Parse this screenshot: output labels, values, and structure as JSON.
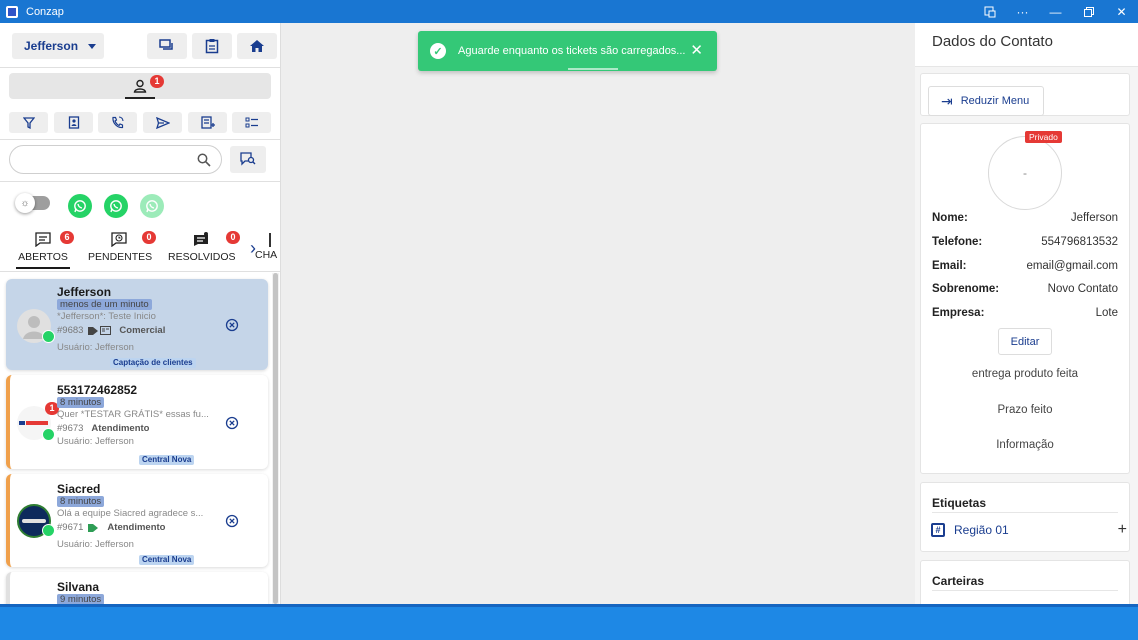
{
  "window": {
    "title": "Conzap"
  },
  "header": {
    "user_name": "Jefferson"
  },
  "person_tab": {
    "badge": "1"
  },
  "search": {
    "placeholder": ""
  },
  "tabs": [
    {
      "label": "ABERTOS",
      "badge": "6"
    },
    {
      "label": "PENDENTES",
      "badge": "0"
    },
    {
      "label": "RESOLVIDOS",
      "badge": "0"
    },
    {
      "label": "CHA"
    }
  ],
  "tickets": [
    {
      "name": "Jefferson",
      "time": "menos de um minuto",
      "message": "*Jefferson*: Teste Inicio",
      "ticket_id": "#9683",
      "queue": "Comercial",
      "user": "Usuário: Jefferson",
      "group": "Captação de clientes"
    },
    {
      "name": "553172462852",
      "time": "8 minutos",
      "message": "Quer *TESTAR GRÁTIS* essas fu...",
      "ticket_id": "#9673",
      "queue": "Atendimento",
      "user": "Usuário: Jefferson",
      "group": "Central Nova",
      "unread": "1"
    },
    {
      "name": "Siacred",
      "time": "8 minutos",
      "message": "Olá a equipe Siacred agradece s...",
      "ticket_id": "#9671",
      "queue": "Atendimento",
      "user": "Usuário: Jefferson",
      "group": "Central Nova"
    },
    {
      "name": "Silvana",
      "time": "9 minutos"
    }
  ],
  "toast": {
    "message": "Aguarde enquanto os tickets são carregados..."
  },
  "contact_panel": {
    "title": "Dados do Contato",
    "reduce_label": "Reduzir Menu",
    "privado": "Privado",
    "avatar_text": "-",
    "fields": [
      {
        "label": "Nome:",
        "value": "Jefferson"
      },
      {
        "label": "Telefone:",
        "value": "554796813532"
      },
      {
        "label": "Email:",
        "value": "email@gmail.com"
      },
      {
        "label": "Sobrenome:",
        "value": "Novo Contato"
      },
      {
        "label": "Empresa:",
        "value": "Lote"
      }
    ],
    "edit_label": "Editar",
    "extra_info": [
      "entrega produto feita",
      "Prazo feito",
      "Informação"
    ],
    "tags_title": "Etiquetas",
    "tags": [
      "Região 01"
    ],
    "wallets_title": "Carteiras"
  },
  "colors": {
    "primary": "#1976d2",
    "toast": "#34c877",
    "badge": "#e53935",
    "whatsapp": "#25d366",
    "accent_text": "#1a3d8f"
  }
}
